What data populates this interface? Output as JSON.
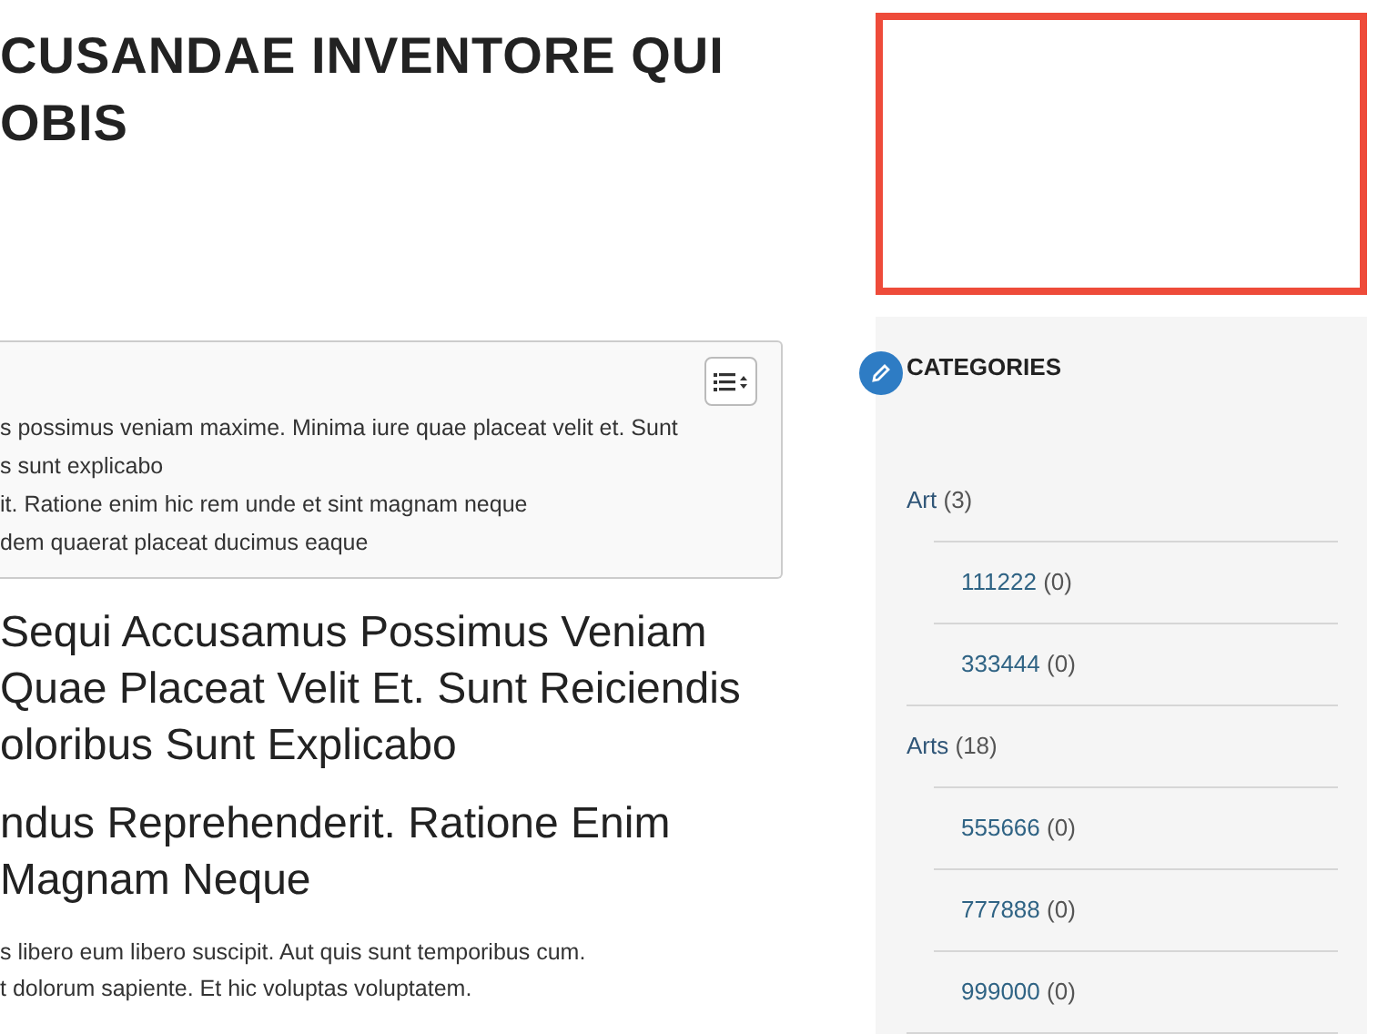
{
  "article": {
    "title_lines": [
      "CUSANDAE INVENTORE QUI",
      "OBIS"
    ],
    "toc": {
      "items": [
        "s possimus veniam maxime. Minima iure quae placeat velit et. Sunt",
        "s sunt explicabo",
        "it. Ratione enim hic rem unde et sint magnam neque",
        "dem quaerat placeat ducimus eaque"
      ]
    },
    "headings": [
      {
        "lines": [
          "Sequi Accusamus Possimus Veniam",
          "Quae Placeat Velit Et. Sunt Reiciendis",
          "oloribus Sunt Explicabo"
        ]
      },
      {
        "lines": [
          "ndus Reprehenderit. Ratione Enim",
          "Magnam Neque"
        ]
      }
    ],
    "paragraph_lines": [
      "s libero eum libero suscipit. Aut quis sunt temporibus cum.",
      "t dolorum sapiente. Et hic voluptas voluptatem."
    ]
  },
  "sidebar": {
    "widget_title": "CATEGORIES",
    "categories": [
      {
        "name": "Art",
        "count": "(3)",
        "children": [
          {
            "name": "111222",
            "count": "(0)"
          },
          {
            "name": "333444",
            "count": "(0)"
          }
        ]
      },
      {
        "name": "Arts",
        "count": "(18)",
        "children": [
          {
            "name": "555666",
            "count": "(0)"
          },
          {
            "name": "777888",
            "count": "(0)"
          },
          {
            "name": "999000",
            "count": "(0)"
          }
        ]
      }
    ]
  }
}
